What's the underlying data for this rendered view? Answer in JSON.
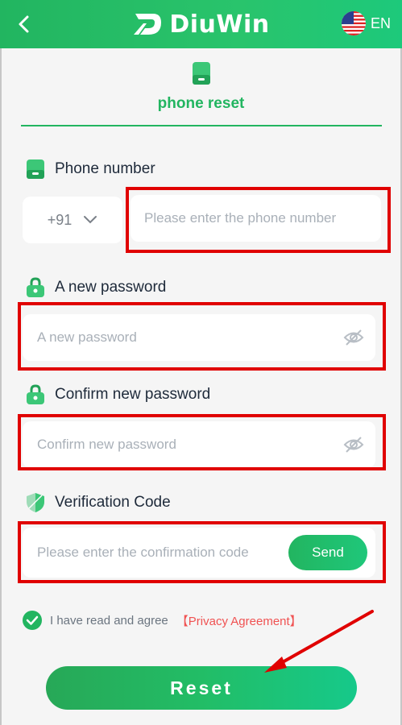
{
  "header": {
    "brand": "DiuWin",
    "language": "EN"
  },
  "page": {
    "title": "phone reset"
  },
  "phone": {
    "label": "Phone number",
    "country_code": "+91",
    "placeholder": "Please enter the phone number"
  },
  "new_password": {
    "label": "A new password",
    "placeholder": "A new password"
  },
  "confirm_password": {
    "label": "Confirm new password",
    "placeholder": "Confirm new password"
  },
  "verification": {
    "label": "Verification Code",
    "placeholder": "Please enter the confirmation code",
    "send_label": "Send"
  },
  "agreement": {
    "text": "I have read and agree",
    "link": "【Privacy Agreement】",
    "checked": true
  },
  "actions": {
    "reset_label": "Reset"
  },
  "colors": {
    "brand_green": "#22b560",
    "highlight_red": "#e00000",
    "link_red": "#f05252"
  },
  "icons": {
    "back": "chevron-left-icon",
    "flag": "us-flag-icon",
    "phone": "phone-icon",
    "lock": "lock-icon",
    "shield": "shield-icon",
    "eye_off": "eye-off-icon",
    "check": "check-circle-icon",
    "chevron_down": "chevron-down-icon"
  }
}
